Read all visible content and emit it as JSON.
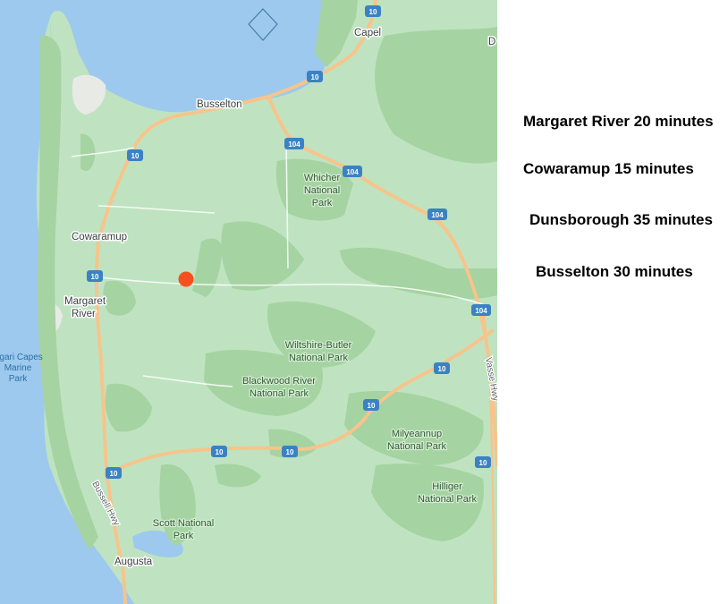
{
  "map": {
    "colors": {
      "water": "#9dc9ef",
      "land": "#bfe3c0",
      "park": "#a5d3a2",
      "road": "#f6c48c",
      "shield": "#3b82c4",
      "marker": "#f4511e",
      "panel": "#ffffff"
    },
    "places": {
      "capel": "Capel",
      "busselton": "Busselton",
      "cowaramup": "Cowaramup",
      "margaret_river_1": "Margaret",
      "margaret_river_2": "River",
      "augusta": "Augusta"
    },
    "parks": {
      "whicher_1": "Whicher",
      "whicher_2": "National",
      "whicher_3": "Park",
      "wiltshire_1": "Wiltshire-Butler",
      "wiltshire_2": "National Park",
      "blackwood_1": "Blackwood River",
      "blackwood_2": "National Park",
      "milyeannup_1": "Milyeannup",
      "milyeannup_2": "National Park",
      "hilliger_1": "Hilliger",
      "hilliger_2": "National Park",
      "scott_1": "Scott National",
      "scott_2": "Park",
      "ngari_1": "Ngari Capes",
      "ngari_2": "Marine",
      "ngari_3": "Park"
    },
    "roads": {
      "bussell_hwy": "Bussell Hwy",
      "vasse_hwy": "Vasse Hwy"
    },
    "shields": {
      "route_10": "10",
      "route_104": "104"
    },
    "edge_letter": "D",
    "marker_icon": "location-dot-icon"
  },
  "travel_times": [
    {
      "label": "Margaret River 20 minutes"
    },
    {
      "label": "Cowaramup 15 minutes"
    },
    {
      "label": "Dunsborough 35 minutes"
    },
    {
      "label": "Busselton 30 minutes"
    }
  ]
}
